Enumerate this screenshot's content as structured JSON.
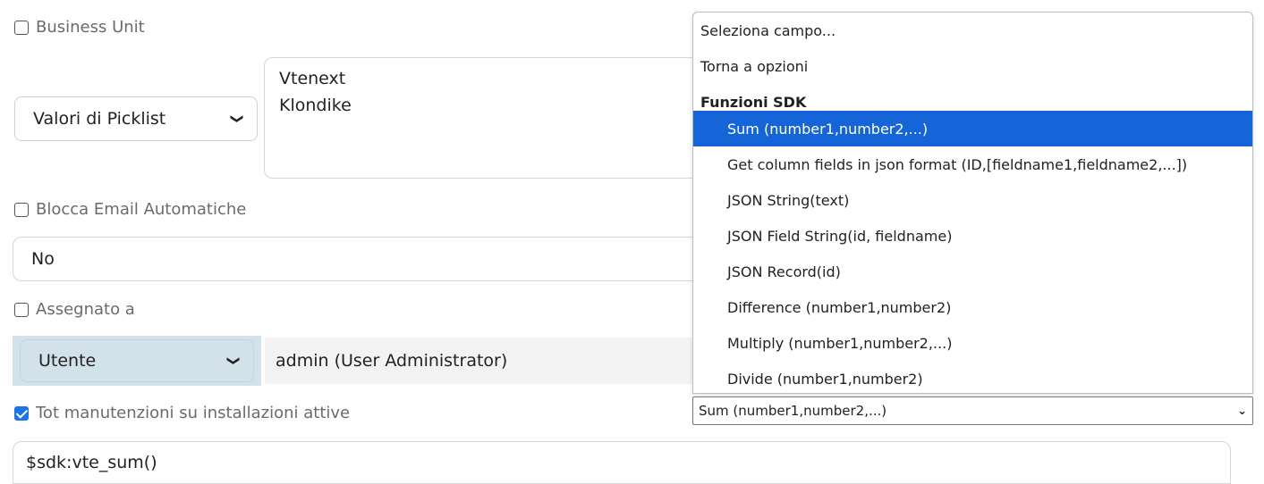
{
  "business_unit": {
    "checkbox_label": "Business Unit",
    "checked": false,
    "picklist_select": "Valori di Picklist",
    "values": [
      "Vtenext",
      "Klondike"
    ]
  },
  "blocca_email": {
    "checkbox_label": "Blocca Email Automatiche",
    "checked": false,
    "value": "No"
  },
  "assegnato": {
    "checkbox_label": "Assegnato a",
    "checked": false,
    "type_select": "Utente",
    "user_value": "admin (User Administrator)"
  },
  "tot_manutenzioni": {
    "checkbox_label": "Tot manutenzioni su installazioni attive",
    "checked": true,
    "value": "$sdk:vte_sum()"
  },
  "field_dropdown": {
    "items": [
      {
        "label": "Seleziona campo...",
        "kind": "option"
      },
      {
        "label": "Torna a opzioni",
        "kind": "option"
      },
      {
        "label": "Funzioni SDK",
        "kind": "group"
      },
      {
        "label": "Sum (number1,number2,...)",
        "kind": "indent",
        "selected": true
      },
      {
        "label": "Get column fields in json format (ID,[fieldname1,fieldname2,...])",
        "kind": "indent"
      },
      {
        "label": "JSON String(text)",
        "kind": "indent"
      },
      {
        "label": "JSON Field String(id, fieldname)",
        "kind": "indent"
      },
      {
        "label": "JSON Record(id)",
        "kind": "indent"
      },
      {
        "label": "Difference (number1,number2)",
        "kind": "indent"
      },
      {
        "label": "Multiply (number1,number2,...)",
        "kind": "indent"
      },
      {
        "label": "Divide (number1,number2)",
        "kind": "indent"
      }
    ],
    "current_value": "Sum (number1,number2,...)"
  }
}
